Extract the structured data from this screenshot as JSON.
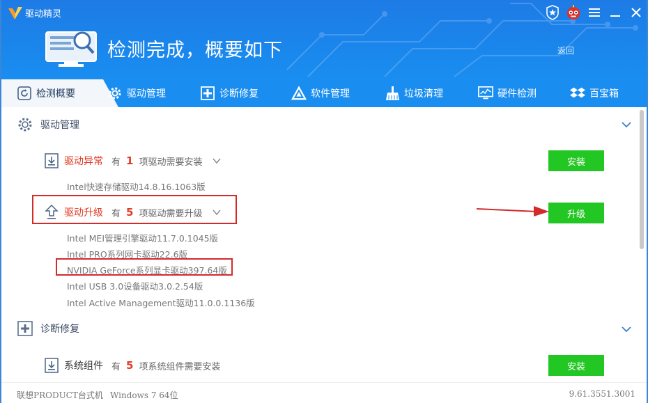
{
  "app": {
    "name": "驱动精灵"
  },
  "window_controls": [
    "star-badge",
    "robot-avatar",
    "menu",
    "minimize",
    "close"
  ],
  "header": {
    "headline": "检测完成，概要如下",
    "back_label": "返回"
  },
  "tabs": [
    {
      "label": "检测概要",
      "icon": "refresh-icon",
      "active": true
    },
    {
      "label": "驱动管理",
      "icon": "gear-icon",
      "active": false
    },
    {
      "label": "诊断修复",
      "icon": "medical-cross-icon",
      "active": false
    },
    {
      "label": "软件管理",
      "icon": "triangle-logo-icon",
      "active": false
    },
    {
      "label": "垃圾清理",
      "icon": "broom-icon",
      "active": false
    },
    {
      "label": "硬件检测",
      "icon": "monitor-chart-icon",
      "active": false
    },
    {
      "label": "百宝箱",
      "icon": "dropbox-icon",
      "active": false
    }
  ],
  "sections": {
    "driver": {
      "title": "驱动管理",
      "abnormal": {
        "title": "驱动异常",
        "prefix": "有",
        "count": "1",
        "suffix": "项驱动需要安装",
        "button": "安装",
        "items": [
          "Intel快速存储驱动14.8.16.1063版"
        ]
      },
      "upgrade": {
        "title": "驱动升级",
        "prefix": "有",
        "count": "5",
        "suffix": "项驱动需要升级",
        "button": "升级",
        "items": [
          "Intel MEI管理引擎驱动11.7.0.1045版",
          "Intel PRO系列网卡驱动22.6版",
          "NVIDIA GeForce系列显卡驱动397.64版",
          "Intel USB 3.0设备驱动3.0.2.54版",
          "Intel Active Management驱动11.0.0.1136版"
        ]
      }
    },
    "diagnose": {
      "title": "诊断修复",
      "components": {
        "title": "系统组件",
        "prefix": "有",
        "count": "5",
        "suffix": "项系统组件需要安装",
        "button": "安装"
      }
    }
  },
  "status": {
    "pc": "联想PRODUCT台式机",
    "os": "Windows 7 64位",
    "version": "9.61.3551.3001"
  },
  "colors": {
    "header_blue": "#1a86ec",
    "accent_red": "#e03b25",
    "button_green": "#23c723",
    "highlight_red": "#d32a2a"
  }
}
